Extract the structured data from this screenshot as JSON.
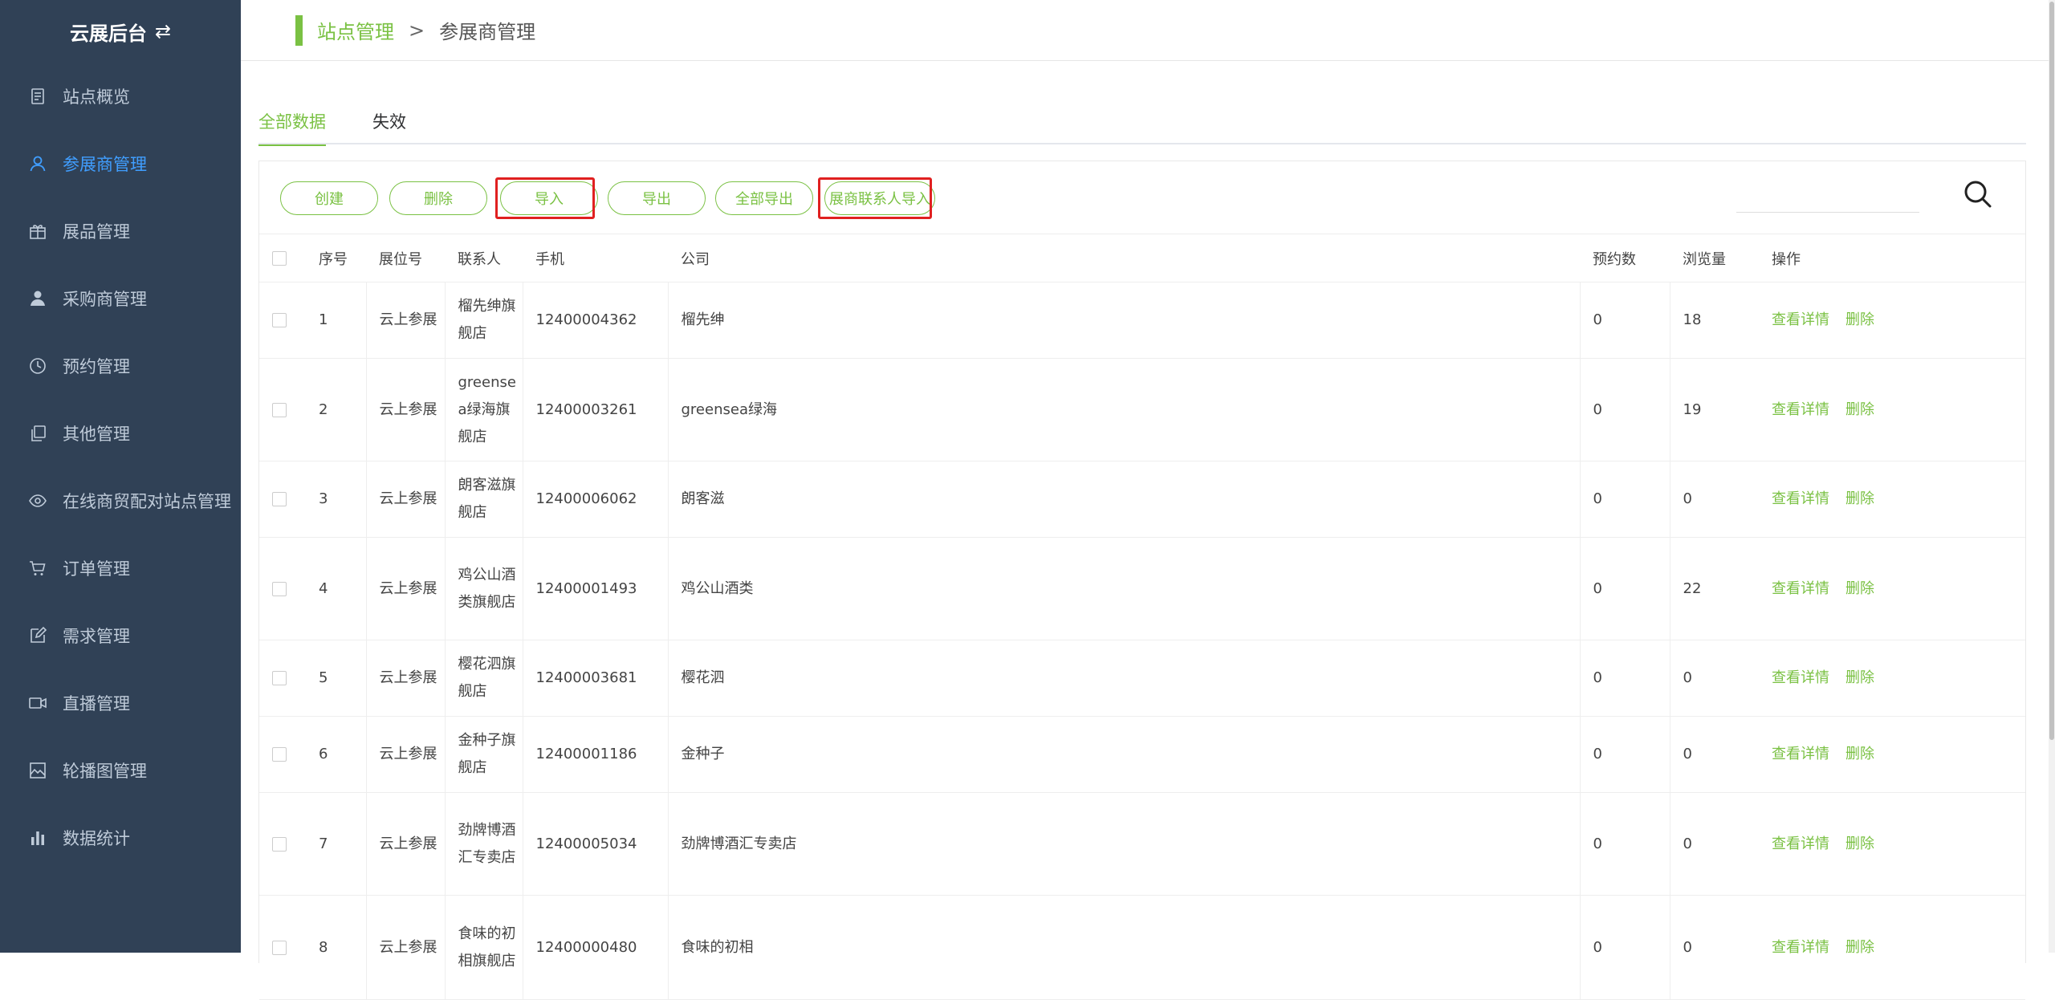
{
  "sidebar": {
    "brand": "云展后台",
    "brand_icon": "swap-icon",
    "items": [
      {
        "label": "站点概览",
        "icon": "overview-icon",
        "active": false
      },
      {
        "label": "参展商管理",
        "icon": "user-icon",
        "active": true
      },
      {
        "label": "展品管理",
        "icon": "gift-icon",
        "active": false
      },
      {
        "label": "采购商管理",
        "icon": "person-icon",
        "active": false
      },
      {
        "label": "预约管理",
        "icon": "clock-icon",
        "active": false
      },
      {
        "label": "其他管理",
        "icon": "copy-icon",
        "active": false
      },
      {
        "label": "在线商贸配对站点管理",
        "icon": "eye-icon",
        "active": false
      },
      {
        "label": "订单管理",
        "icon": "cart-icon",
        "active": false
      },
      {
        "label": "需求管理",
        "icon": "edit-icon",
        "active": false
      },
      {
        "label": "直播管理",
        "icon": "video-icon",
        "active": false
      },
      {
        "label": "轮播图管理",
        "icon": "image-icon",
        "active": false
      },
      {
        "label": "数据统计",
        "icon": "bar-chart-icon",
        "active": false
      }
    ]
  },
  "breadcrumb": {
    "link": "站点管理",
    "separator": ">",
    "current": "参展商管理"
  },
  "tabs": [
    {
      "label": "全部数据",
      "active": true
    },
    {
      "label": "失效",
      "active": false
    }
  ],
  "toolbar": {
    "create": "创建",
    "delete": "删除",
    "import": "导入",
    "export": "导出",
    "export_all": "全部导出",
    "contact_import": "展商联系人导入",
    "search_placeholder": ""
  },
  "table": {
    "headers": {
      "index": "序号",
      "booth": "展位号",
      "contact": "联系人",
      "phone": "手机",
      "company": "公司",
      "bookings": "预约数",
      "views": "浏览量",
      "actions": "操作"
    },
    "action_view": "查看详情",
    "action_delete": "删除",
    "rows": [
      {
        "index": "1",
        "booth": "云上参展",
        "contact": "榴先绅旗舰店",
        "phone": "12400004362",
        "company": "榴先绅",
        "bookings": "0",
        "views": "18"
      },
      {
        "index": "2",
        "booth": "云上参展",
        "contact": "greensea绿海旗舰店",
        "phone": "12400003261",
        "company": "greensea绿海",
        "bookings": "0",
        "views": "19"
      },
      {
        "index": "3",
        "booth": "云上参展",
        "contact": "朗客滋旗舰店",
        "phone": "12400006062",
        "company": "朗客滋",
        "bookings": "0",
        "views": "0"
      },
      {
        "index": "4",
        "booth": "云上参展",
        "contact": "鸡公山酒类旗舰店",
        "phone": "12400001493",
        "company": "鸡公山酒类",
        "bookings": "0",
        "views": "22"
      },
      {
        "index": "5",
        "booth": "云上参展",
        "contact": "樱花泗旗舰店",
        "phone": "12400003681",
        "company": "樱花泗",
        "bookings": "0",
        "views": "0"
      },
      {
        "index": "6",
        "booth": "云上参展",
        "contact": "金种子旗舰店",
        "phone": "12400001186",
        "company": "金种子",
        "bookings": "0",
        "views": "0"
      },
      {
        "index": "7",
        "booth": "云上参展",
        "contact": "劲牌博酒汇专卖店",
        "phone": "12400005034",
        "company": "劲牌博酒汇专卖店",
        "bookings": "0",
        "views": "0"
      },
      {
        "index": "8",
        "booth": "云上参展",
        "contact": "食味的初相旗舰店",
        "phone": "12400000480",
        "company": "食味的初相",
        "bookings": "0",
        "views": "0"
      }
    ]
  },
  "colors": {
    "sidebar_bg": "#304156",
    "accent": "#7ac143",
    "active_nav": "#409eff",
    "highlight_box": "#e02020"
  }
}
